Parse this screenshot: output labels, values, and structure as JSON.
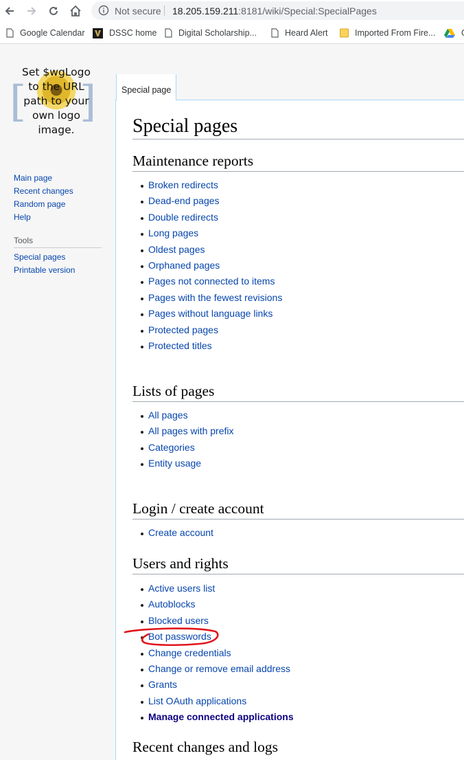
{
  "browser": {
    "security_label": "Not secure",
    "url_host": "18.205.159.211",
    "url_rest": ":8181/wiki/Special:SpecialPages",
    "bookmarks": [
      "Google Calendar",
      "DSSC home",
      "Digital Scholarship...",
      "Heard Alert",
      "Imported From Fire...",
      "G"
    ]
  },
  "logo": {
    "text_lines": [
      "Set $wgLogo",
      "to the URL",
      "path to your",
      "own logo",
      "image."
    ]
  },
  "sidebar": {
    "navigation": [
      "Main page",
      "Recent changes",
      "Random page",
      "Help"
    ],
    "tools_heading": "Tools",
    "tools": [
      "Special pages",
      "Printable version"
    ]
  },
  "tab": {
    "label": "Special page"
  },
  "page": {
    "title": "Special pages",
    "sections": [
      {
        "heading": "Maintenance reports",
        "items": [
          "Broken redirects",
          "Dead-end pages",
          "Double redirects",
          "Long pages",
          "Oldest pages",
          "Orphaned pages",
          "Pages not connected to items",
          "Pages with the fewest revisions",
          "Pages without language links",
          "Protected pages",
          "Protected titles"
        ]
      },
      {
        "heading": "Lists of pages",
        "items": [
          "All pages",
          "All pages with prefix",
          "Categories",
          "Entity usage"
        ]
      },
      {
        "heading": "Login / create account",
        "items": [
          "Create account"
        ]
      },
      {
        "heading": "Users and rights",
        "items": [
          "Active users list",
          "Autoblocks",
          "Blocked users",
          "Bot passwords",
          "Change credentials",
          "Change or remove email address",
          "Grants",
          "List OAuth applications",
          "Manage connected applications"
        ]
      },
      {
        "heading": "Recent changes and logs",
        "items": []
      }
    ]
  },
  "colors": {
    "link": "#0645ad",
    "visited_bold_link": "#0b0080",
    "annotation": "#e0151b"
  }
}
